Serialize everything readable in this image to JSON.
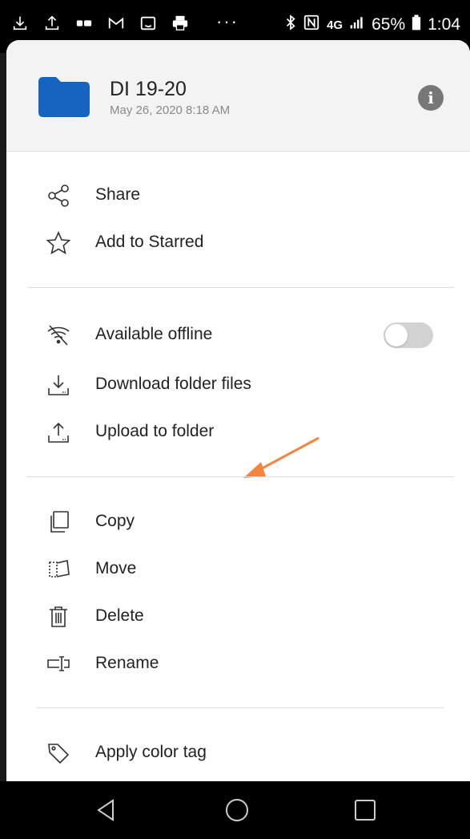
{
  "status_bar": {
    "left_icons": [
      "download-icon",
      "upload-icon",
      "network-icon",
      "gmail-icon",
      "amazon-icon",
      "print-icon"
    ],
    "overflow": "···",
    "network_label": "4G",
    "battery_percent": "65%",
    "time": "1:04"
  },
  "folder": {
    "name": "DI 19-20",
    "date": "May 26, 2020 8:18 AM",
    "color": "#1565c0"
  },
  "menu": {
    "share": "Share",
    "add_starred": "Add to Starred",
    "available_offline": "Available offline",
    "available_offline_enabled": false,
    "download_folder_files": "Download folder files",
    "upload_to_folder": "Upload to folder",
    "copy": "Copy",
    "move": "Move",
    "delete": "Delete",
    "rename": "Rename",
    "apply_color_tag": "Apply color tag"
  },
  "annotation_color": "#f5843e",
  "nav": [
    "back-icon",
    "home-icon",
    "recents-icon"
  ]
}
